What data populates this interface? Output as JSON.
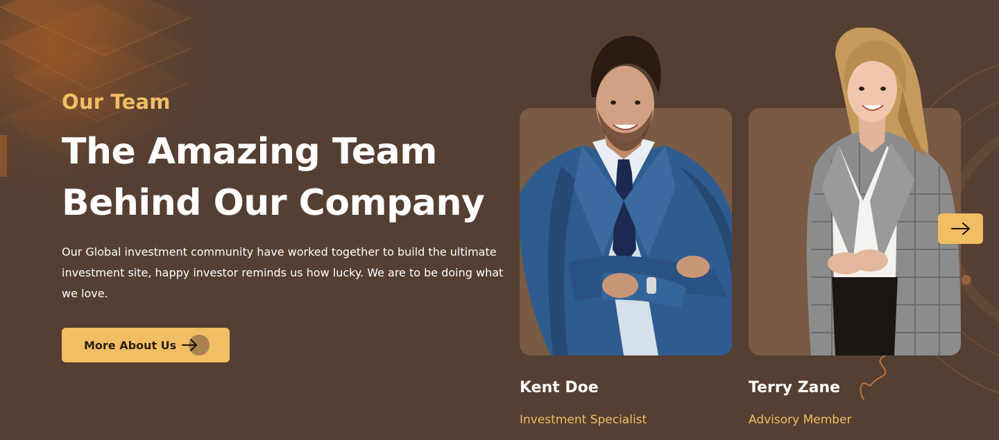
{
  "section": {
    "eyebrow": "Our Team",
    "headline": "The Amazing Team Behind Our Company",
    "description": "Our Global investment community have worked together to build the ultimate investment site, happy investor reminds us how lucky. We are to be doing what we love.",
    "cta_label": "More About Us",
    "cta_icon": "arrow-right-icon"
  },
  "team": [
    {
      "name": "Kent Doe",
      "role": "Investment Specialist"
    },
    {
      "name": "Terry Zane",
      "role": "Advisory Member"
    }
  ],
  "carousel": {
    "next_icon": "arrow-right-icon"
  },
  "colors": {
    "background": "#553f32",
    "accent": "#f2be64",
    "card": "#795a44",
    "text": "#ffffff"
  }
}
